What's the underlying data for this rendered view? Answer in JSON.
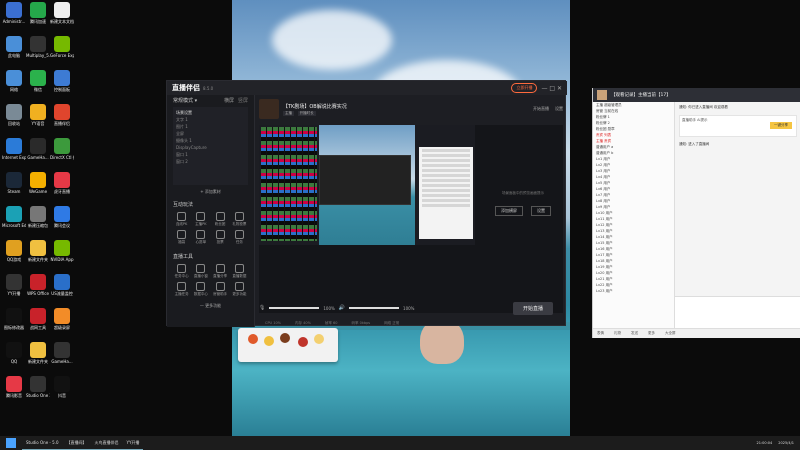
{
  "desktop_icons": [
    {
      "label": "Administr...",
      "color": "#3b6fd1"
    },
    {
      "label": "腾讯加速",
      "color": "#25a84a"
    },
    {
      "label": "新建文本文档",
      "color": "#eeeeee"
    },
    {
      "label": "此电脑",
      "color": "#4a8fd8"
    },
    {
      "label": "Multiplay_5...",
      "color": "#333333"
    },
    {
      "label": "GeForce Experience",
      "color": "#76b900"
    },
    {
      "label": "网络",
      "color": "#4a8fd8"
    },
    {
      "label": "微信",
      "color": "#2bb24c"
    },
    {
      "label": "控制面板",
      "color": "#3d7bd4"
    },
    {
      "label": "回收站",
      "color": "#7a8a96"
    },
    {
      "label": "YY语音",
      "color": "#f0b020"
    },
    {
      "label": "直播伴侣",
      "color": "#e0452d"
    },
    {
      "label": "Internet Explorer",
      "color": "#2b7bd8"
    },
    {
      "label": "GameHa...",
      "color": "#2a2a2a"
    },
    {
      "label": "DirectX Ctl 修复工具",
      "color": "#3c9a3c"
    },
    {
      "label": "Steam",
      "color": "#1b2838"
    },
    {
      "label": "WeGame",
      "color": "#f4b000"
    },
    {
      "label": "虎牙直播",
      "color": "#e63946"
    },
    {
      "label": "Microsoft Edge",
      "color": "#1ba1b5"
    },
    {
      "label": "新建压缩包",
      "color": "#777777"
    },
    {
      "label": "腾讯会议",
      "color": "#2f7ae5"
    },
    {
      "label": "QQ游戏",
      "color": "#e0a020"
    },
    {
      "label": "新建文件夹",
      "color": "#f0c040"
    },
    {
      "label": "NVIDIA App",
      "color": "#76b900"
    },
    {
      "label": "YY开播",
      "color": "#333333"
    },
    {
      "label": "WPS Office",
      "color": "#c8222a"
    },
    {
      "label": "US流量监控",
      "color": "#2a6fc9"
    },
    {
      "label": "图标修改器",
      "color": "#111111"
    },
    {
      "label": "战网工具",
      "color": "#c8222a"
    },
    {
      "label": "超级录屏",
      "color": "#f28c28"
    },
    {
      "label": "QQ",
      "color": "#111111"
    },
    {
      "label": "新建文件夹",
      "color": "#f0c040"
    },
    {
      "label": "GameHa...",
      "color": "#333333"
    },
    {
      "label": "腾讯影音",
      "color": "#e63946"
    },
    {
      "label": "Studio One 3.5.6",
      "color": "#333333"
    },
    {
      "label": "抖音",
      "color": "#111111"
    }
  ],
  "app": {
    "logo": "直播伴侣",
    "version": "8.5.0",
    "top_button": "立即开播",
    "win_controls": "— □ ✕",
    "sidebar": {
      "mode_label": "常规模式 ▾",
      "tab_a": "横屏",
      "tab_b": "竖屏",
      "scene_list_title": "场景设置",
      "scenes": [
        "文字 1",
        "图片 1",
        "全屏",
        "摄像头 1",
        "DisplayCapture",
        "窗口 1",
        "窗口 2"
      ],
      "add_source": "+ 添加素材",
      "interact_title": "互动玩法",
      "interact": [
        "连线PK",
        "主播PK",
        "粉丝团",
        "礼物投票",
        "福袋",
        "心愿单",
        "投票",
        "任务"
      ],
      "tools_title": "直播工具",
      "tools": [
        "任务中心",
        "直播小窗",
        "直播分享",
        "直播数据",
        "主播任务",
        "数据中心",
        "房管助手",
        "更多功能"
      ],
      "more": "— 更多功能"
    },
    "room": {
      "name": "【TK剧场】OB解说比赛实况",
      "tags": [
        "主播",
        "开播时长"
      ],
      "streaming_btn": "开始直播",
      "settings": "设置"
    },
    "preview_right": {
      "hint": "场景面板中的预览画面提示",
      "btn_a": "添加横屏",
      "btn_b": "设置"
    },
    "controls": {
      "mic_pct": "100%",
      "vol_pct": "100%",
      "golive": "开始直播"
    },
    "status": [
      "CPU 10%",
      "内存 40%",
      "帧率 60",
      "码率 0kbps",
      "网络 正常"
    ]
  },
  "chat_panel": {
    "title": "【观看记录】主播当前【17】",
    "users": [
      "主播 超级管理员",
      "房管 当前在线",
      "粉丝牌 1",
      "粉丝牌 2",
      "粉丝团 勋章",
      "贵宾 列表",
      "主播 贵宾",
      "普通用户 a",
      "普通用户 b",
      "Lv1 用户",
      "Lv2 用户",
      "Lv3 用户",
      "Lv4 用户",
      "Lv5 用户",
      "Lv6 用户",
      "Lv7 用户",
      "Lv8 用户",
      "Lv9 用户",
      "Lv10 用户",
      "Lv11 用户",
      "Lv12 用户",
      "Lv13 用户",
      "Lv14 用户",
      "Lv15 用户",
      "Lv16 用户",
      "Lv17 用户",
      "Lv18 用户",
      "Lv19 用户",
      "Lv20 用户",
      "Lv21 用户",
      "Lv22 用户",
      "Lv23 用户"
    ],
    "msg1": "通知: 你已进入直播间 欢迎观看",
    "card_title": "直播助手 Ai提示",
    "card_btn": "一键分享",
    "msg2": "通知: 进入了直播间",
    "bottom": [
      "表情",
      "礼物",
      "发送",
      "更多",
      "大全屏"
    ]
  },
  "taskbar": {
    "items": [
      "Studio One - 5.0",
      "【直播间】",
      "火鸟直播伴侣",
      "YY开播"
    ],
    "time": "21:00:04",
    "date": "2025/4/1"
  }
}
